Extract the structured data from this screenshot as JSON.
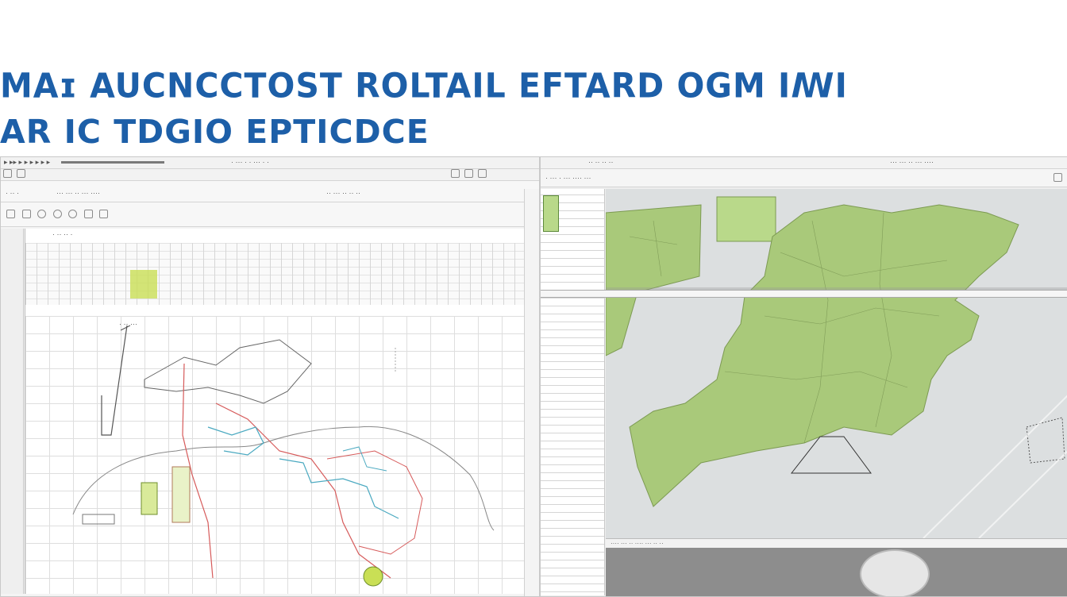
{
  "heading": {
    "line1": "MAɪ AUCNCCTOST ROLTAIL EFTARD OGM  IꟿI",
    "line2": "AR IC TDGIO EPTICDCE"
  },
  "left_window": {
    "menu_text": "▸ ▸▸ ▸ ▸ ▸ ▸ ▸ ▸",
    "toolbar_label": "· ··· · · ··· · ·",
    "row2_left": "· ·· ·",
    "row2_mid": "··· ··· ·· ··· ····",
    "row2_right": "·· ··· ·· ·· ··",
    "zoom_label": "· ·· ·· ·",
    "annotation_1": "· ·· ···"
  },
  "right_window": {
    "tab_label": "·· ·· ·· ··",
    "status_text": "··· ··· ·· ··· ····",
    "panel_heading": "· ··· · ··· ···· ···",
    "footer_text": "···· ··· ·· ···· ··· ·· ··"
  },
  "colors": {
    "heading": "#1d5fa8",
    "land": "#a9c97a",
    "water": "#dcdfe0",
    "route_red": "#d65a5a",
    "route_teal": "#4aa9c0",
    "route_green": "#9ac24a"
  }
}
